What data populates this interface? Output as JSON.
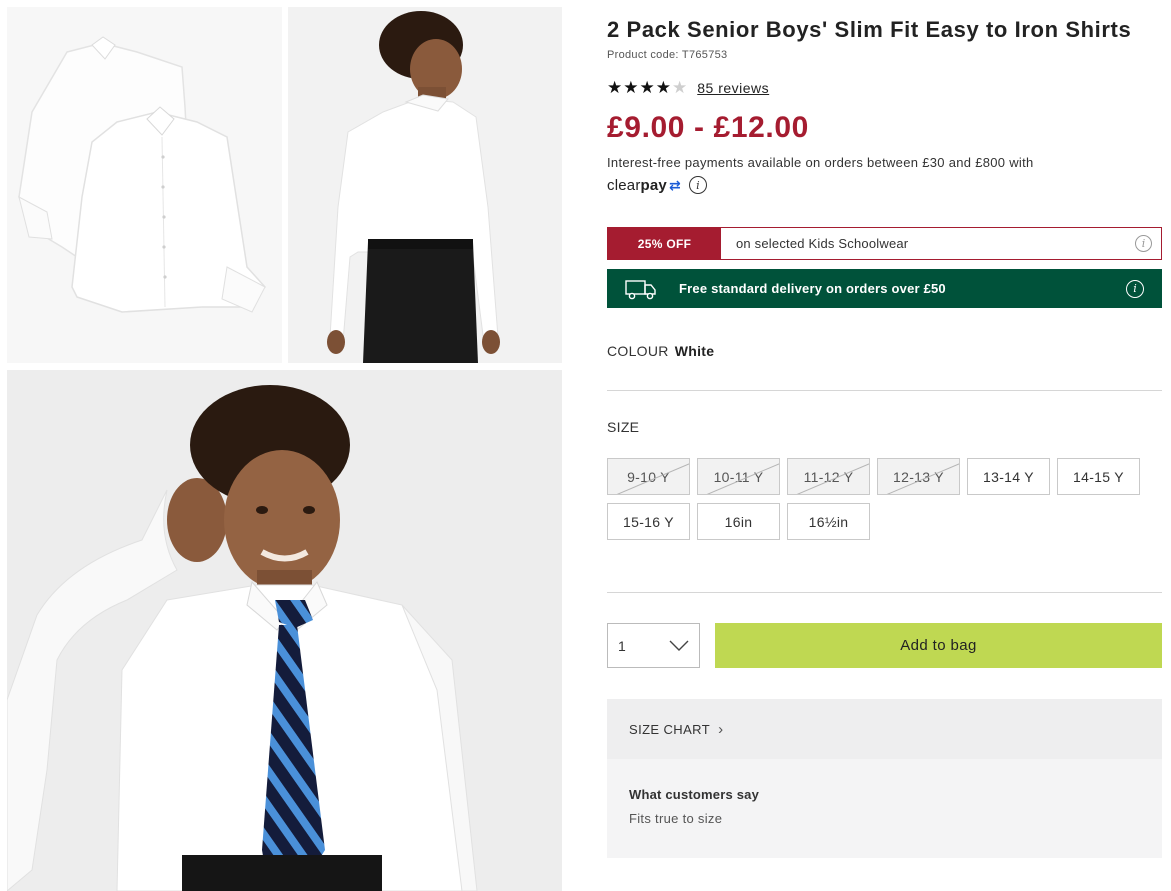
{
  "product": {
    "title": "2 Pack Senior Boys' Slim Fit Easy to Iron Shirts",
    "code": "Product code: T765753",
    "rating": 4,
    "rating_max": 5,
    "reviews": "85 reviews",
    "price": "£9.00 - £12.00"
  },
  "payments": {
    "text": "Interest-free payments available on orders between £30 and £800 with",
    "provider_a": "clear",
    "provider_b": "pay"
  },
  "promo": {
    "badge": "25% OFF",
    "text": "on selected Kids Schoolwear"
  },
  "delivery": {
    "text": "Free standard delivery on orders over £50"
  },
  "colour": {
    "label": "COLOUR",
    "value": "White"
  },
  "size": {
    "label": "SIZE",
    "options": [
      {
        "label": "9-10 Y",
        "available": false
      },
      {
        "label": "10-11 Y",
        "available": false
      },
      {
        "label": "11-12 Y",
        "available": false
      },
      {
        "label": "12-13 Y",
        "available": false
      },
      {
        "label": "13-14 Y",
        "available": true
      },
      {
        "label": "14-15 Y",
        "available": true
      },
      {
        "label": "15-16 Y",
        "available": true
      },
      {
        "label": "16in",
        "available": true
      },
      {
        "label": "16½in",
        "available": true
      }
    ]
  },
  "purchase": {
    "quantity": "1",
    "add_label": "Add to bag"
  },
  "size_chart": {
    "label": "SIZE CHART"
  },
  "customers": {
    "heading": "What customers say",
    "text": "Fits true to size"
  },
  "colors": {
    "price": "#a51c30",
    "delivery_bg": "#00523a",
    "add_bg": "#bfd852"
  }
}
